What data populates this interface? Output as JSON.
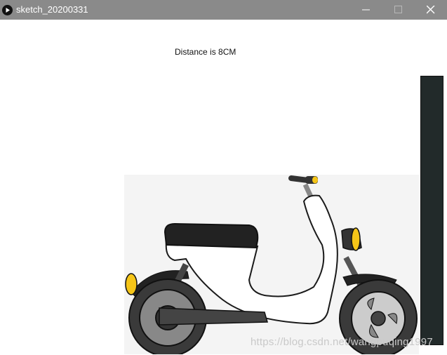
{
  "window": {
    "title": "sketch_20200331"
  },
  "sketch": {
    "distance_text": "Distance is 8CM"
  },
  "watermark": "https://blog.csdn.net/wangpuqing1997",
  "colors": {
    "titlebar": "#8a8a8a",
    "panel": "#222a2a",
    "scooter_body": "#ffffff",
    "seat": "#222222",
    "lamp": "#f5c518",
    "tire": "#3a3a3a",
    "rim": "#888888"
  }
}
